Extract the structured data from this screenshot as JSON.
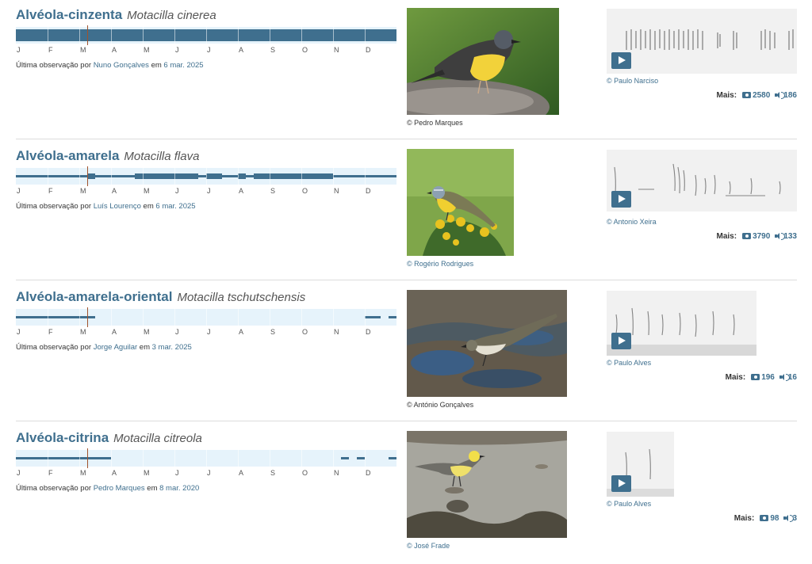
{
  "months": [
    "J",
    "F",
    "M",
    "A",
    "M",
    "J",
    "J",
    "A",
    "S",
    "O",
    "N",
    "D"
  ],
  "ui": {
    "more_label": "Mais:"
  },
  "colors": {
    "accent": "#3f6f8e",
    "bar_background": "#e6f3fb",
    "today_marker": "#a0522d"
  },
  "species": [
    {
      "common_name": "Alvéola-cinzenta",
      "scientific_name": "Motacilla cinerea",
      "last_obs_prefix": "Última observação por",
      "observer": "Nuno Gonçalves",
      "last_obs_mid": "em",
      "date": "6 mar. 2025",
      "photo_credit": "© Pedro Marques",
      "sound_credit": "© Paulo Narciso",
      "photo_count": "2580",
      "sound_count": "186",
      "phenology": [
        3,
        3,
        3,
        3,
        3,
        3,
        3,
        3,
        3,
        3,
        3,
        3,
        3,
        3,
        3,
        3,
        3,
        3,
        3,
        3,
        3,
        3,
        3,
        3,
        3,
        3,
        3,
        3,
        3,
        3,
        3,
        3,
        3,
        3,
        3,
        3,
        3,
        3,
        3,
        3,
        3,
        3,
        3,
        3,
        3,
        3,
        3,
        3
      ]
    },
    {
      "common_name": "Alvéola-amarela",
      "scientific_name": "Motacilla flava",
      "last_obs_prefix": "Última observação por",
      "observer": "Luís Lourenço",
      "last_obs_mid": "em",
      "date": "6 mar. 2025",
      "photo_credit": "© Rogério Rodrigues",
      "sound_credit": "© Antonio Xeira",
      "photo_count": "3790",
      "sound_count": "133",
      "phenology": [
        1,
        1,
        1,
        1,
        1,
        1,
        1,
        1,
        1,
        2,
        1,
        1,
        1,
        1,
        1,
        2,
        2,
        2,
        2,
        2,
        2,
        2,
        2,
        1,
        2,
        2,
        1,
        1,
        2,
        1,
        2,
        2,
        2,
        2,
        2,
        2,
        2,
        2,
        2,
        2,
        1,
        1,
        1,
        1,
        1,
        1,
        1,
        1
      ]
    },
    {
      "common_name": "Alvéola-amarela-oriental",
      "scientific_name": "Motacilla tschutschensis",
      "last_obs_prefix": "Última observação por",
      "observer": "Jorge Aguilar",
      "last_obs_mid": "em",
      "date": "3 mar. 2025",
      "photo_credit": "© António Gonçalves",
      "sound_credit": "© Paulo Alves",
      "photo_count": "196",
      "sound_count": "16",
      "phenology": [
        1,
        1,
        1,
        1,
        1,
        1,
        1,
        1,
        1,
        1,
        0,
        0,
        0,
        0,
        0,
        0,
        0,
        0,
        0,
        0,
        0,
        0,
        0,
        0,
        0,
        0,
        0,
        0,
        0,
        0,
        0,
        0,
        0,
        0,
        0,
        0,
        0,
        0,
        0,
        0,
        0,
        0,
        0,
        0,
        1,
        1,
        0,
        1
      ]
    },
    {
      "common_name": "Alvéola-citrina",
      "scientific_name": "Motacilla citreola",
      "last_obs_prefix": "Última observação por",
      "observer": "Pedro Marques",
      "last_obs_mid": "em",
      "date": "8 mar. 2020",
      "photo_credit": "© José Frade",
      "sound_credit": "© Paulo Alves",
      "photo_count": "98",
      "sound_count": "3",
      "phenology": [
        1,
        1,
        1,
        1,
        1,
        1,
        1,
        1,
        1,
        1,
        1,
        1,
        0,
        0,
        0,
        0,
        0,
        0,
        0,
        0,
        0,
        0,
        0,
        0,
        0,
        0,
        0,
        0,
        0,
        0,
        0,
        0,
        0,
        0,
        0,
        0,
        0,
        0,
        0,
        0,
        0,
        1,
        0,
        1,
        0,
        0,
        0,
        1
      ]
    }
  ]
}
